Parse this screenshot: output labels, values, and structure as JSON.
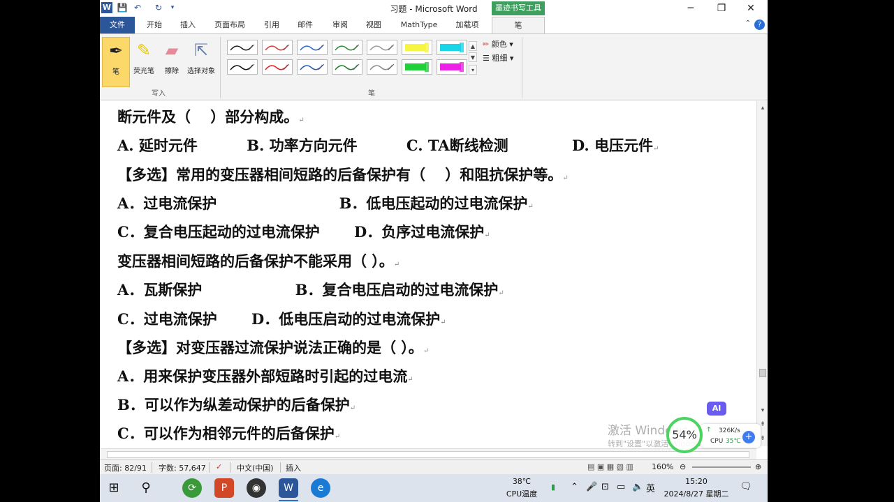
{
  "window": {
    "title": "习题 - Microsoft Word",
    "context_tab_label": "墨迹书写工具",
    "controls": {
      "minimize": "─",
      "restore": "❐",
      "close": "✕"
    }
  },
  "quick_access": {
    "word_logo": "W",
    "save": "💾",
    "undo": "↶",
    "redo": "↻",
    "customize": "▾"
  },
  "tabs": [
    {
      "label": "文件"
    },
    {
      "label": "开始"
    },
    {
      "label": "插入"
    },
    {
      "label": "页面布局"
    },
    {
      "label": "引用"
    },
    {
      "label": "邮件"
    },
    {
      "label": "审阅"
    },
    {
      "label": "视图"
    },
    {
      "label": "MathType"
    },
    {
      "label": "加载项"
    },
    {
      "label": "笔"
    }
  ],
  "ribbon": {
    "tools": {
      "pen": "笔",
      "highlighter": "荧光笔",
      "eraser": "擦除",
      "select": "选择对象"
    },
    "group_write": "写入",
    "group_pens": "笔",
    "color_label": "颜色",
    "thickness_label": "粗细",
    "pen_colors_row1": [
      "#222222",
      "#d43a3a",
      "#2f66c4",
      "#2e8a3a",
      "#9a9a9a",
      "#f5f542",
      "#18d6e8"
    ],
    "pen_colors_row2": [
      "#111111",
      "#e02020",
      "#2a58b0",
      "#1f7a2c",
      "#8a8a8a",
      "#22d13a",
      "#ee20e8"
    ]
  },
  "document": {
    "lines": [
      "断元件及（　 ）部分构成。",
      "A. 延时元件　　　 B. 功率方向元件　　　 C. TA断线检测　　　　 D. 电压元件",
      "【多选】常用的变压器相间短路的后备保护有（　 ）和阻抗保护等。",
      "A．过电流保护　　　　　　　　 B．低电压起动的过电流保护",
      "C．复合电压起动的过电流保护　　 D．负序过电流保护",
      "变压器相间短路的后备保护不能采用（ ）。",
      "A．瓦斯保护　　　　　　 B．复合电压启动的过电流保护",
      "C．过电流保护　　 D．低电压启动的过电流保护",
      "【多选】对变压器过流保护说法正确的是（ ）。",
      "A．用来保护变压器外部短路时引起的过电流",
      "B．可以作为纵差动保护的后备保护",
      "C．可以作为相邻元件的后备保护"
    ],
    "paragraph_mark": "↵"
  },
  "status": {
    "page": "页面: 82/91",
    "words": "字数: 57,647",
    "language": "中文(中国)",
    "mode": "插入",
    "zoom": "160%"
  },
  "overlays": {
    "activation": "激活 Windows",
    "activation_sub": "转到\"设置\"以激活 Windows。",
    "ai_badge": "AI",
    "perf_percent": "54%",
    "net_speed": "326K/s",
    "cpu_label": "CPU",
    "cpu_temp": "35℃"
  },
  "taskbar": {
    "cpu_temp": "38℃",
    "cpu_label": "CPU温度",
    "ime": "英",
    "time": "15:20",
    "date": "2024/8/27 星期二"
  }
}
